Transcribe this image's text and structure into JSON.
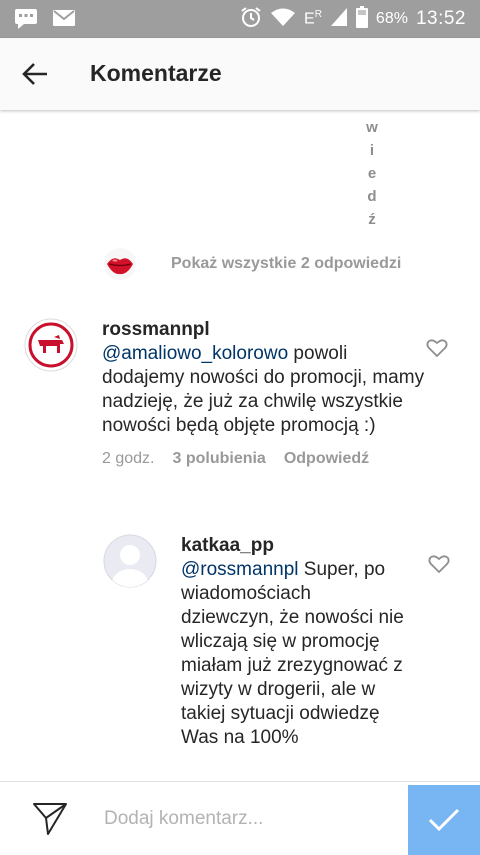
{
  "status_bar": {
    "battery": "68%",
    "time": "13:52",
    "network_label": "E",
    "network_sup": "R",
    "icons": [
      "message-icon",
      "mail-icon",
      "alarm-icon",
      "wifi-icon",
      "signal-icon",
      "battery-icon"
    ]
  },
  "header": {
    "title": "Komentarze"
  },
  "truncated_text": {
    "letters": [
      "w",
      "i",
      "e",
      "d",
      "ź"
    ]
  },
  "replies": {
    "show_all_label": "Pokaż wszystkie 2 odpowiedzi"
  },
  "comments": [
    {
      "username": "rossmannpl",
      "mention": "@amaliowo_kolorowo",
      "text": " powoli dodajemy nowości do promocji, mamy nadzieję, że już za chwilę wszystkie nowości będą objęte promocją :)",
      "time": "2 godz.",
      "likes": "3 polubienia",
      "reply_label": "Odpowiedź"
    },
    {
      "username": "katkaa_pp",
      "mention": "@rossmannpl",
      "text": " Super, po wiadomościach dziewczyn, że nowości nie wliczają się w promocję miałam już zrezygnować z wizyty w drogerii, ale w takiej sytuacji odwiedzę Was na 100%"
    }
  ],
  "composer": {
    "placeholder": "Dodaj komentarz..."
  },
  "colors": {
    "status_bar": "#9e9e9e",
    "mention": "#003569",
    "post_button": "#4a9ef0",
    "rossmann_red": "#c8102e"
  }
}
